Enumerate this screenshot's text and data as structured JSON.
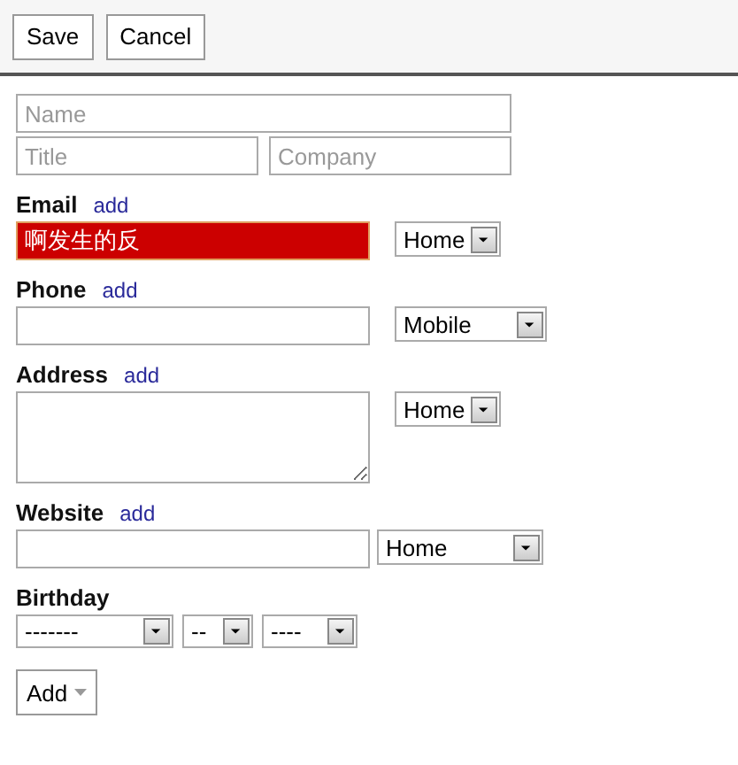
{
  "toolbar": {
    "buttons": [
      "Save",
      "Cancel"
    ]
  },
  "name_fields": {
    "name": {
      "placeholder": "Name"
    },
    "title": {
      "placeholder": "Title"
    },
    "company": {
      "placeholder": "Company"
    }
  },
  "sections": [
    {
      "kind": "input",
      "label": "Email",
      "link": "add",
      "value": "啊发生的反",
      "highlighted": true,
      "type_select": "Home"
    },
    {
      "kind": "input",
      "label": "Phone",
      "link": "add",
      "highlighted": false,
      "type_select": "Mobile"
    },
    {
      "kind": "textarea",
      "label": "Address",
      "link": "add",
      "highlighted": false,
      "type_select": "Home"
    },
    {
      "kind": "input",
      "label": "Website",
      "link": "add",
      "highlighted": false,
      "type_select": "Home"
    },
    {
      "kind": "date",
      "label": "Birthday",
      "selects": [
        "-------",
        "--",
        "----"
      ]
    }
  ],
  "add_button": "Add"
}
